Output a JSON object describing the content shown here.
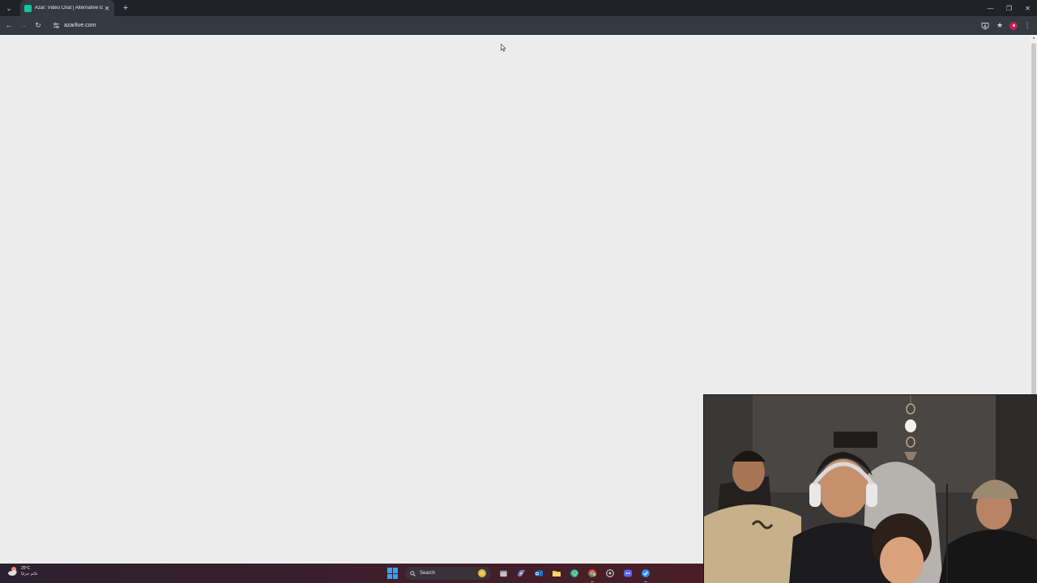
{
  "browser": {
    "tab": {
      "title": "Azar: Video Chat | Alternative to",
      "close_glyph": "✕",
      "favicon_color": "#18c29c"
    },
    "new_tab_glyph": "+",
    "tab_list_glyph": "⌄",
    "window_controls": {
      "minimize": "—",
      "restore": "❐",
      "close": "✕"
    },
    "url": "azarlive.com",
    "nav": {
      "back": "←",
      "forward": "→",
      "reload": "↻"
    },
    "bookmark_glyph": "★",
    "menu_glyph": "⋮"
  },
  "page": {
    "background": "#ececec"
  },
  "taskbar": {
    "weather": {
      "temp": "25°C",
      "desc": "غائم جزئيًا"
    },
    "search_label": "Search",
    "apps": [
      "file-explorer-icon",
      "copilot-icon",
      "outlook-icon",
      "folder-icon",
      "edge-icon",
      "chrome-icon",
      "settings-icon",
      "discord-icon",
      "app-icon"
    ]
  }
}
